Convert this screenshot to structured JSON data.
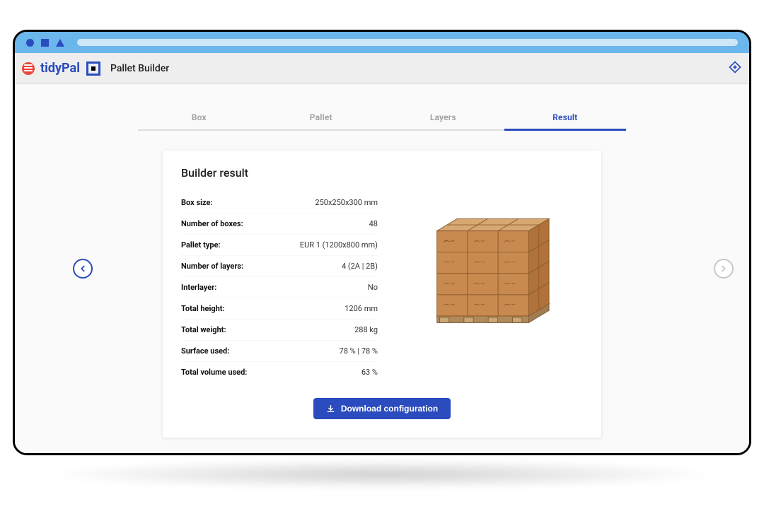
{
  "brand": {
    "name": "tidyPal"
  },
  "app": {
    "title": "Pallet Builder"
  },
  "tabs": [
    {
      "label": "Box"
    },
    {
      "label": "Pallet"
    },
    {
      "label": "Layers"
    },
    {
      "label": "Result",
      "active": true
    }
  ],
  "card": {
    "title": "Builder result",
    "specs": [
      {
        "label": "Box size:",
        "value": "250x250x300 mm"
      },
      {
        "label": "Number of boxes:",
        "value": "48"
      },
      {
        "label": "Pallet type:",
        "value": "EUR 1 (1200x800 mm)"
      },
      {
        "label": "Number of layers:",
        "value": "4 (2A | 2B)"
      },
      {
        "label": "Interlayer:",
        "value": "No"
      },
      {
        "label": "Total height:",
        "value": "1206 mm"
      },
      {
        "label": "Total weight:",
        "value": "288 kg"
      },
      {
        "label": "Surface used:",
        "value": "78 % | 78 %"
      },
      {
        "label": "Total volume used:",
        "value": "63 %"
      }
    ],
    "download_label": "Download configuration"
  },
  "colors": {
    "accent": "#2a4cbf",
    "box_fill_light": "#c98a4f",
    "box_fill_dark": "#b17239",
    "box_top": "#d8a873",
    "box_edge": "#8a5a2e",
    "pallet_wood": "#b28a5a",
    "pallet_edge": "#7e5f3b"
  }
}
